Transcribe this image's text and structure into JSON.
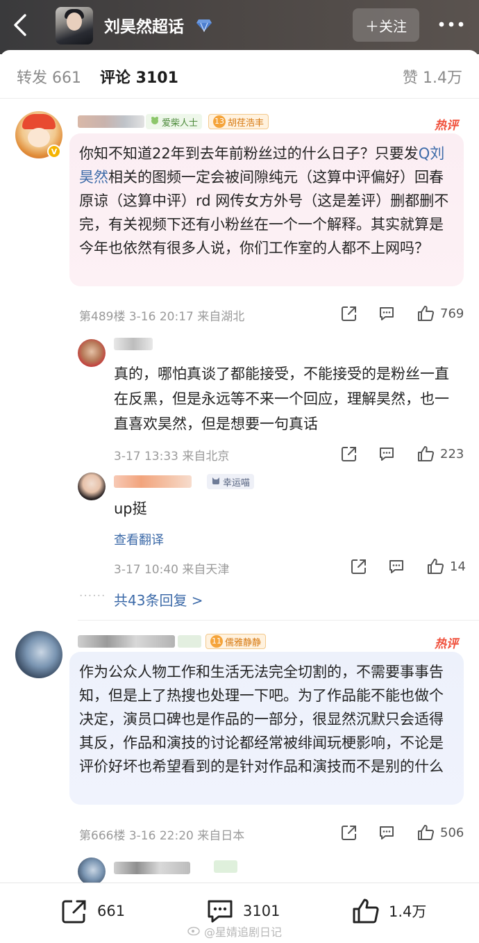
{
  "header": {
    "title": "刘昊然超话",
    "follow_label": "＋关注",
    "more_label": "•••",
    "accent": "#ff8200"
  },
  "tabs": {
    "repost": "转发 661",
    "comment": "评论 3101",
    "like": "赞 1.4万"
  },
  "comments": [
    {
      "tags": {
        "badge": "爱柴人士",
        "fan_level": "13",
        "fan_name": "胡荏浩丰"
      },
      "hot_label": "热评",
      "text_before": "你知不知道22年到去年前粉丝过的什么日子？只要发",
      "topic": "Q刘昊然",
      "text_after": "相关的图频一定会被间隙纯元（这算中评偏好）回春原谅（这算中评）rd 网传女方外号（这是差评）删都删不完，有关视频下还有小粉丝在一个一个解释。其实就算是今年也依然有很多人说，你们工作室的人都不上网吗？",
      "meta": "第489楼 3-16 20:17 来自湖北",
      "likes": "769",
      "replies": [
        {
          "text": "真的，哪怕真谈了都能接受，不能接受的是粉丝一直在反黑，但是永远等不来一个回应，理解昊然，也一直喜欢昊然，但是想要一句真话",
          "meta": "3-17 13:33 来自北京",
          "likes": "223"
        },
        {
          "badge": "幸运喵",
          "text": "up挺",
          "translate": "查看翻译",
          "meta": "3-17 10:40 来自天津",
          "likes": "14"
        }
      ],
      "more_replies": "共43条回复 >"
    },
    {
      "tags": {
        "fan_level": "11",
        "fan_name": "儒雅静静"
      },
      "hot_label": "热评",
      "text": "作为公众人物工作和生活无法完全切割的，不需要事事告知，但是上了热搜也处理一下吧。为了作品能不能也做个决定，演员口碑也是作品的一部分，很显然沉默只会适得其反，作品和演技的讨论都经常被绯闻玩梗影响，不论是评价好坏也希望看到的是针对作品和演技而不是别的什么",
      "meta": "第666楼 3-16 22:20 来自日本",
      "likes": "506"
    }
  ],
  "bottom_bar": {
    "repost": "661",
    "comment": "3101",
    "like": "1.4万"
  },
  "watermark": "@星婧追剧日记"
}
